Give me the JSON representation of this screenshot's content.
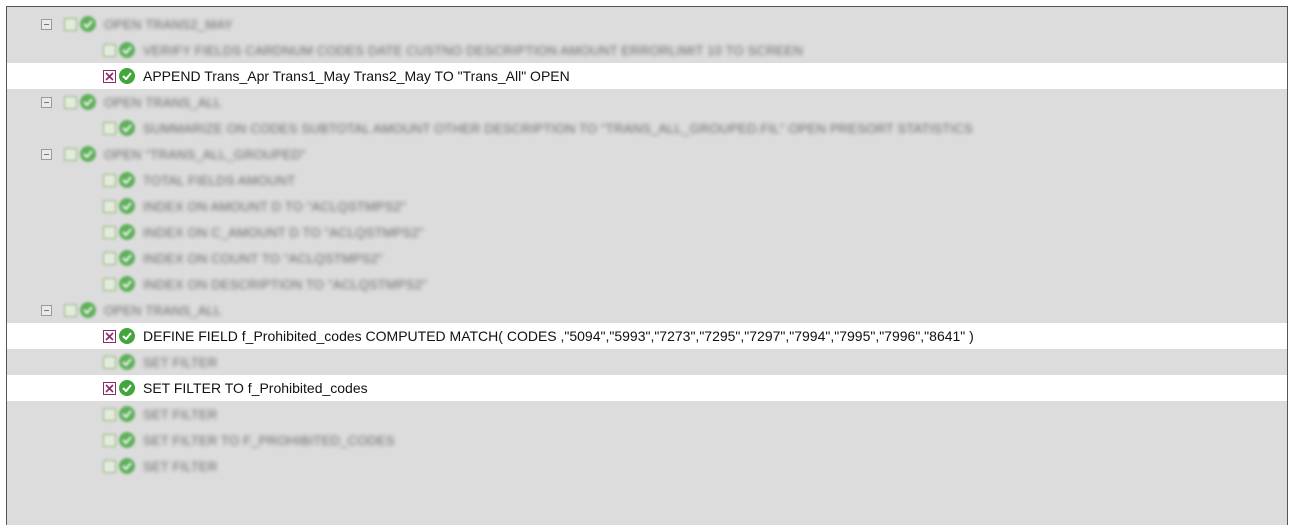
{
  "rows": [
    {
      "text": "OPEN Trans2_May",
      "level": 0,
      "active": false
    },
    {
      "text": "VERIFY FIELDS CARDNUM CODES DATE CUSTNO DESCRIPTION AMOUNT ERRORLIMIT 10 TO SCREEN",
      "level": 1,
      "active": false
    },
    {
      "text": "APPEND  Trans_Apr Trans1_May Trans2_May TO \"Trans_All\" OPEN",
      "level": 1,
      "active": true
    },
    {
      "text": "OPEN Trans_All",
      "level": 0,
      "active": false
    },
    {
      "text": "SUMMARIZE ON CODES SUBTOTAL AMOUNT OTHER DESCRIPTION TO \"Trans_All_Grouped.FIL\" OPEN PRESORT STATISTICS",
      "level": 1,
      "active": false
    },
    {
      "text": "OPEN \"Trans_All_Grouped\"",
      "level": 0,
      "active": false
    },
    {
      "text": "TOTAL FIELDS AMOUNT",
      "level": 1,
      "active": false
    },
    {
      "text": "INDEX ON AMOUNT D TO \"ACLQSTMPS2\"",
      "level": 1,
      "active": false
    },
    {
      "text": "INDEX ON c_AMOUNT D TO \"ACLQSTMPS2\"",
      "level": 1,
      "active": false
    },
    {
      "text": "INDEX ON COUNT TO \"ACLQSTMPS2\"",
      "level": 1,
      "active": false
    },
    {
      "text": "INDEX ON DESCRIPTION TO \"ACLQSTMPS2\"",
      "level": 1,
      "active": false
    },
    {
      "text": "OPEN Trans_All",
      "level": 0,
      "active": false
    },
    {
      "text": "DEFINE FIELD f_Prohibited_codes COMPUTED MATCH( CODES ,\"5094\",\"5993\",\"7273\",\"7295\",\"7297\",\"7994\",\"7995\",\"7996\",\"8641\" )",
      "level": 1,
      "active": true
    },
    {
      "text": "SET FILTER",
      "level": 1,
      "active": false
    },
    {
      "text": "SET FILTER TO f_Prohibited_codes",
      "level": 1,
      "active": true
    },
    {
      "text": "SET FILTER",
      "level": 1,
      "active": false
    },
    {
      "text": "SET FILTER TO f_Prohibited_codes",
      "level": 1,
      "active": false
    },
    {
      "text": "SET FILTER",
      "level": 1,
      "active": false
    }
  ],
  "colors": {
    "background": "#dcdcdc",
    "active_row": "#ffffff",
    "status_ok": "#41a63b",
    "checkbox_checked": "#8a2b6b"
  },
  "icons": {
    "expander": "collapse-icon",
    "checkbox": "checkbox-icon",
    "status": "success-check-icon"
  }
}
